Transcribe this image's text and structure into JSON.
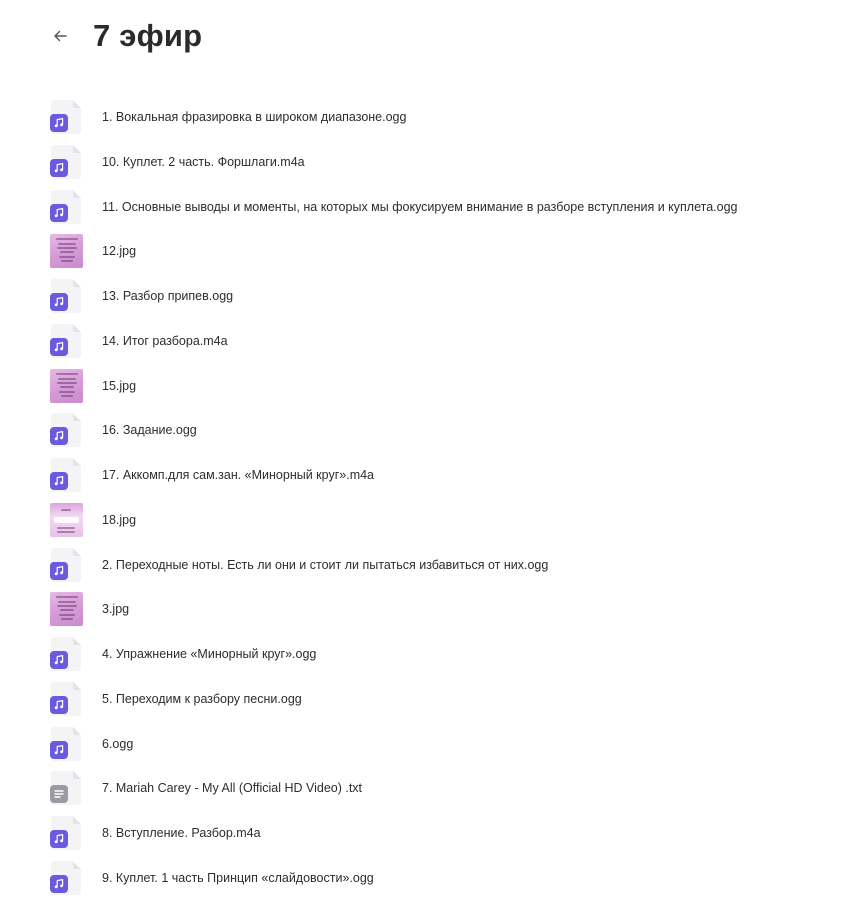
{
  "header": {
    "back_icon": "arrow-left-icon",
    "title": "7 эфир"
  },
  "files": [
    {
      "name": "1. Вокальная фразировка в широком диапазоне.ogg",
      "type": "audio",
      "icon": "music-note-icon"
    },
    {
      "name": "10. Куплет. 2 часть. Форшлаги.m4a",
      "type": "audio",
      "icon": "music-note-icon"
    },
    {
      "name": "11. Основные выводы и моменты, на которых мы фокусируем внимание в разборе вступления и куплета.ogg",
      "type": "audio",
      "icon": "music-note-icon"
    },
    {
      "name": "12.jpg",
      "type": "image",
      "icon": "image-thumbnail"
    },
    {
      "name": "13. Разбор припев.ogg",
      "type": "audio",
      "icon": "music-note-icon"
    },
    {
      "name": "14. Итог разбора.m4a",
      "type": "audio",
      "icon": "music-note-icon"
    },
    {
      "name": "15.jpg",
      "type": "image",
      "icon": "image-thumbnail"
    },
    {
      "name": "16. Задание.ogg",
      "type": "audio",
      "icon": "music-note-icon"
    },
    {
      "name": "17. Аккомп.для сам.зан. «Минорный круг».m4a",
      "type": "audio",
      "icon": "music-note-icon"
    },
    {
      "name": "18.jpg",
      "type": "image",
      "icon": "image-thumbnail"
    },
    {
      "name": "2. Переходные ноты. Есть ли они и стоит ли пытаться избавиться от них.ogg",
      "type": "audio",
      "icon": "music-note-icon"
    },
    {
      "name": "3.jpg",
      "type": "image",
      "icon": "image-thumbnail"
    },
    {
      "name": "4. Упражнение «Минорный круг».ogg",
      "type": "audio",
      "icon": "music-note-icon"
    },
    {
      "name": "5. Переходим к разбору песни.ogg",
      "type": "audio",
      "icon": "music-note-icon"
    },
    {
      "name": "6.ogg",
      "type": "audio",
      "icon": "music-note-icon"
    },
    {
      "name": "7. Mariah Carey - My All (Official HD Video) .txt",
      "type": "text",
      "icon": "text-lines-icon"
    },
    {
      "name": "8. Вступление. Разбор.m4a",
      "type": "audio",
      "icon": "music-note-icon"
    },
    {
      "name": "9. Куплет. 1 часть Принцип «слайдовости».ogg",
      "type": "audio",
      "icon": "music-note-icon"
    }
  ],
  "colors": {
    "audio_badge": "#6a5ae0",
    "text_badge": "#9a9aa6",
    "image_thumb": "#d49ad6",
    "title": "#2b2b2b"
  }
}
